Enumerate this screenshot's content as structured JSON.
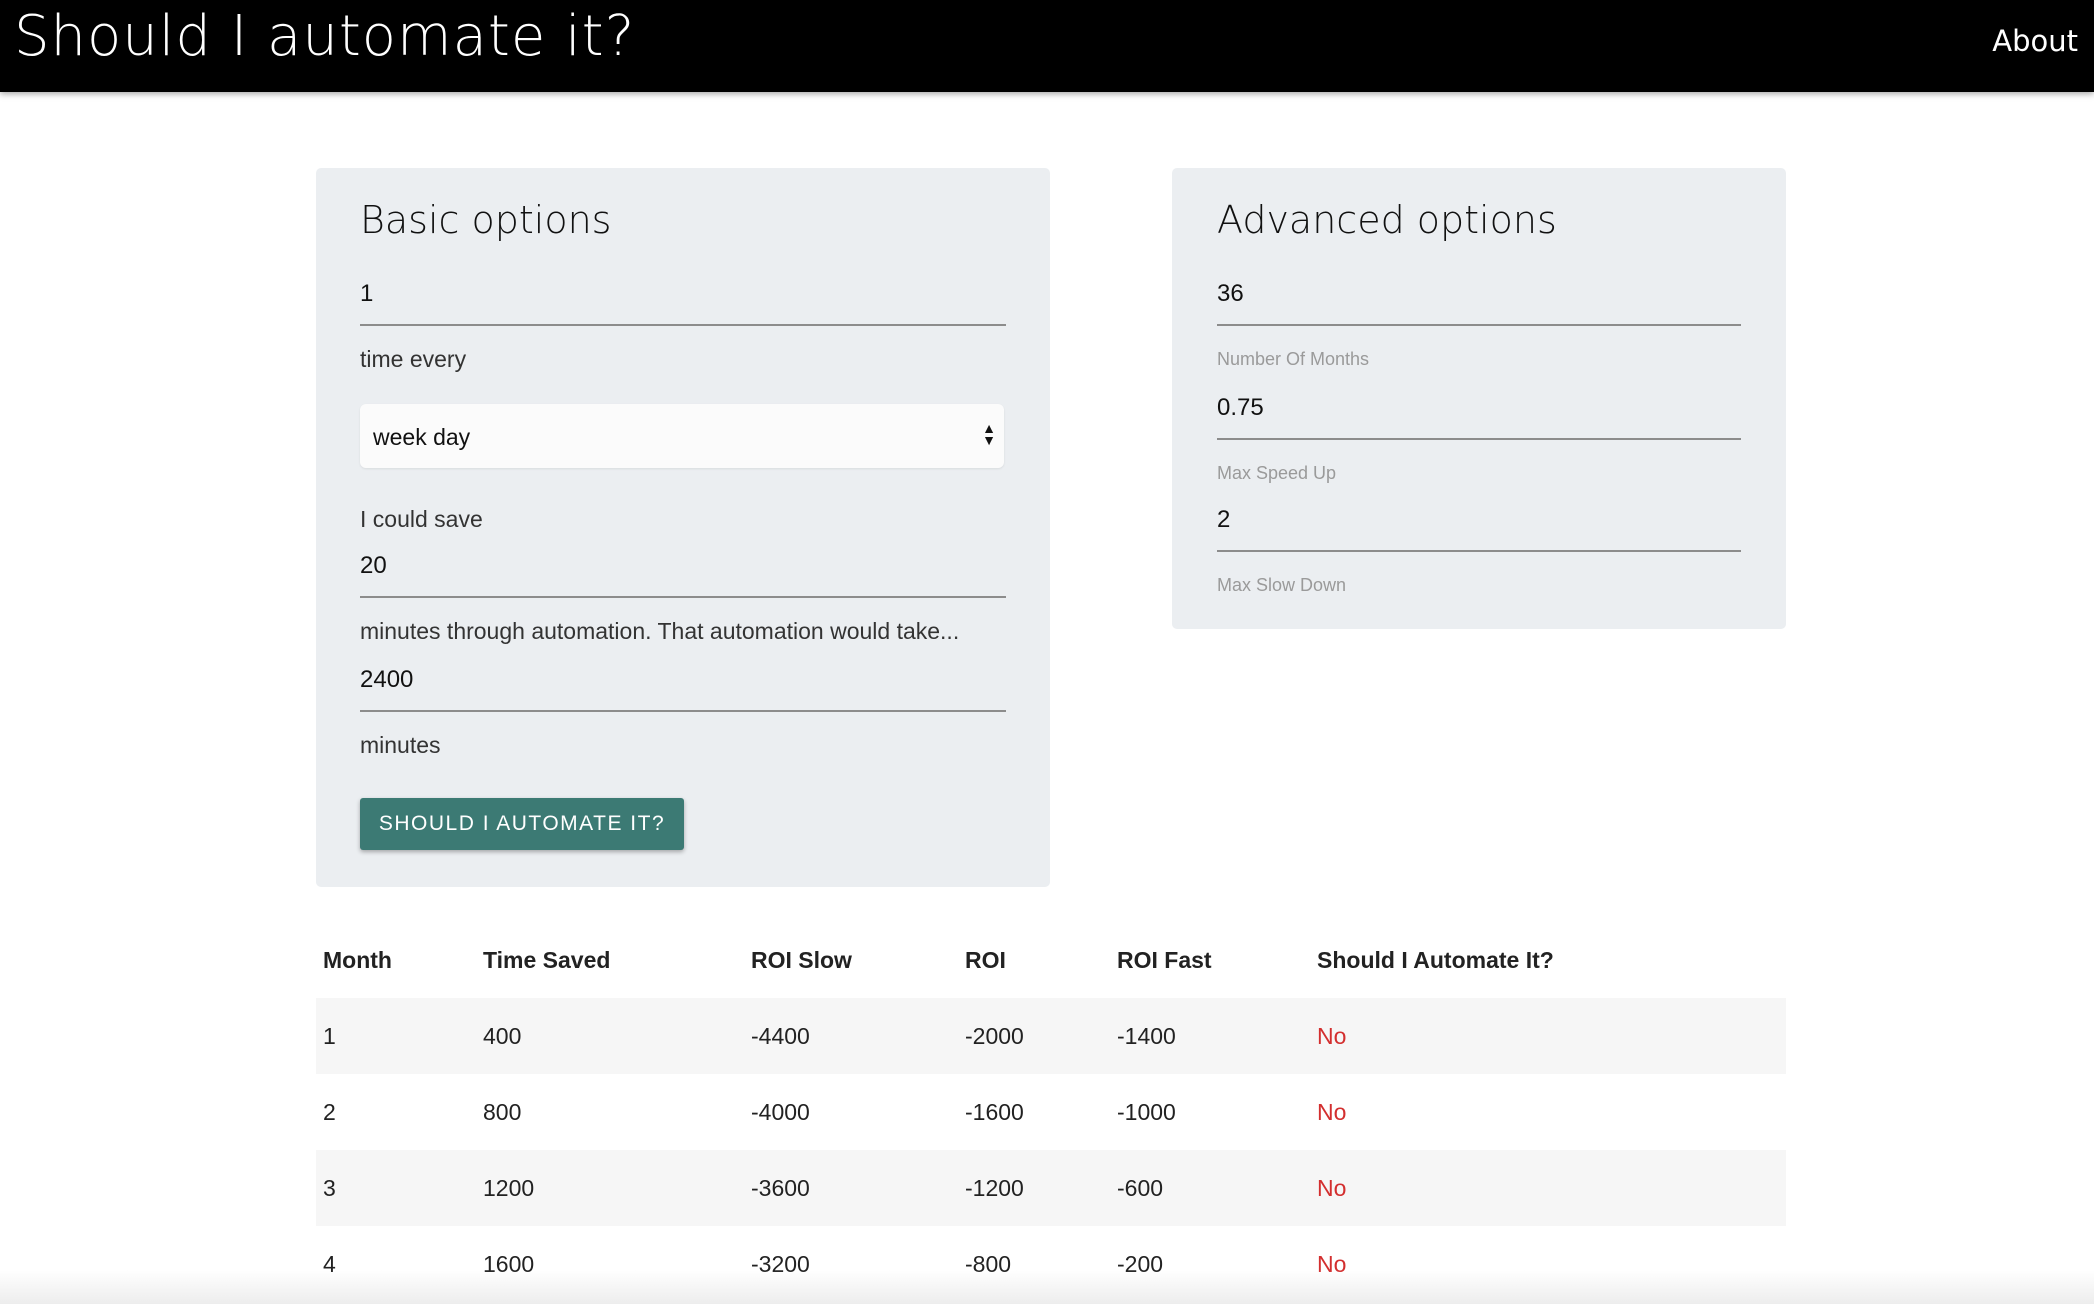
{
  "header": {
    "title": "Should I automate it?",
    "about_label": "About"
  },
  "basic": {
    "title": "Basic options",
    "times_value": "1",
    "time_every_label": "time every",
    "period_selected": "week day",
    "could_save_label": "I could save",
    "minutes_saved_value": "20",
    "automation_take_label": "minutes through automation. That automation would take...",
    "automation_minutes_value": "2400",
    "minutes_label": "minutes",
    "submit_label": "SHOULD I AUTOMATE IT?"
  },
  "advanced": {
    "title": "Advanced options",
    "months_value": "36",
    "months_help": "Number Of Months",
    "speedup_value": "0.75",
    "speedup_help": "Max Speed Up",
    "slowdown_value": "2",
    "slowdown_help": "Max Slow Down"
  },
  "results": {
    "headers": [
      "Month",
      "Time Saved",
      "ROI Slow",
      "ROI",
      "ROI Fast",
      "Should I Automate It?"
    ],
    "rows": [
      [
        "1",
        "400",
        "-4400",
        "-2000",
        "-1400",
        "No"
      ],
      [
        "2",
        "800",
        "-4000",
        "-1600",
        "-1000",
        "No"
      ],
      [
        "3",
        "1200",
        "-3600",
        "-1200",
        "-600",
        "No"
      ],
      [
        "4",
        "1600",
        "-3200",
        "-800",
        "-200",
        "No"
      ]
    ]
  },
  "colors": {
    "nav_bg": "#000000",
    "card_bg": "#ebeef1",
    "button_bg": "#3c7a74",
    "no_text": "#d32f2f"
  }
}
